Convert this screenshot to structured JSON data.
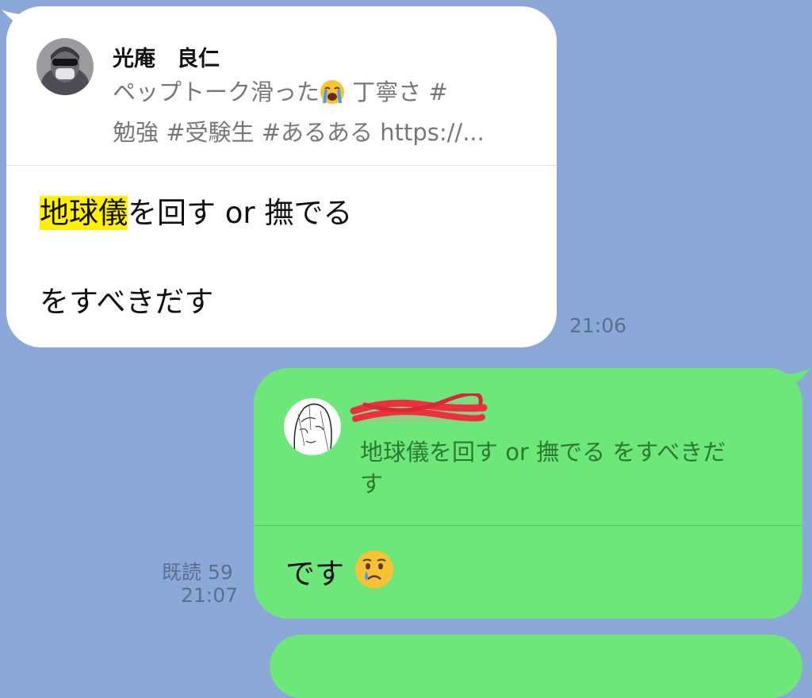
{
  "incoming": {
    "quote": {
      "name": "光庵　良仁",
      "preview_part1": "ペップトーク滑った",
      "preview_part2": " 丁寧さ #",
      "preview_line2": "勉強 #受験生 #あるある https://...",
      "emoji": "loudly-crying-face"
    },
    "message": {
      "highlight": "地球儀",
      "line1_rest": "を回す or 撫でる",
      "line2": "をすべきだす"
    },
    "time": "21:06"
  },
  "outgoing": {
    "quote": {
      "name_redacted": true,
      "preview_line1": "地球儀を回す or 撫でる をすべきだ",
      "preview_line2": "す"
    },
    "message": {
      "text": "です",
      "emoji": "crying-face"
    },
    "read_status": "既読 59",
    "time": "21:07"
  },
  "colors": {
    "background": "#8ba8d8",
    "incoming_bubble": "#ffffff",
    "outgoing_bubble": "#6de67a",
    "highlight": "#fff200"
  }
}
